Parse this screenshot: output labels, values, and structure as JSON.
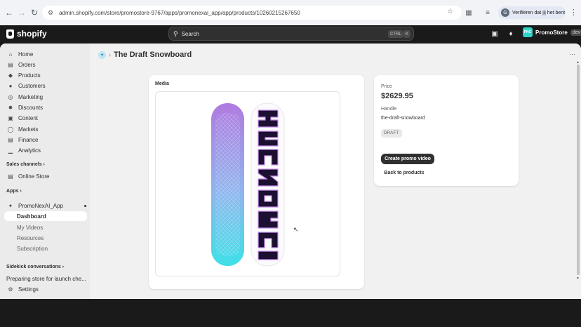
{
  "browser": {
    "url": "admin.shopify.com/store/promostore-9767/apps/promonexai_app/app/products/10260215267650",
    "profile_text": "Verifiëren dat jij het bent",
    "profile_icon": "G"
  },
  "topbar": {
    "logo": "shopify",
    "search_placeholder": "Search",
    "kbd_ctrl": "CTRL",
    "kbd_k": "K",
    "store_initials": "PNC",
    "store_name": "PromoStore",
    "store_tag": "dev"
  },
  "sidebar": {
    "items": [
      {
        "label": "Home",
        "icon": "home-icon"
      },
      {
        "label": "Orders",
        "icon": "inbox-icon"
      },
      {
        "label": "Products",
        "icon": "tag-icon"
      },
      {
        "label": "Customers",
        "icon": "person-icon"
      },
      {
        "label": "Marketing",
        "icon": "target-icon"
      },
      {
        "label": "Discounts",
        "icon": "discount-icon"
      },
      {
        "label": "Content",
        "icon": "content-icon"
      },
      {
        "label": "Markets",
        "icon": "globe-icon"
      },
      {
        "label": "Finance",
        "icon": "bank-icon"
      },
      {
        "label": "Analytics",
        "icon": "chart-icon"
      }
    ],
    "sales_channels_header": "Sales channels",
    "online_store": "Online Store",
    "apps_header": "Apps",
    "app_name": "PromoNexAI_App",
    "app_items": [
      "Dashboard",
      "My Videos",
      "Resources",
      "Subscription"
    ],
    "sidekick_header": "Sidekick conversations",
    "sidekick_item": "Preparing store for launch che...",
    "settings": "Settings"
  },
  "page": {
    "breadcrumb_sep": "›",
    "title": "The Draft Snowboard",
    "media_header": "Media",
    "price_label": "Price",
    "price_value": "$2629.95",
    "handle_label": "Handle",
    "handle_value": "the-draft-snowboard",
    "status_badge": "DRAFT",
    "create_button": "Create promo video",
    "back_button": "Back to products"
  },
  "colors": {
    "accent_dark": "#303030",
    "store_avatar": "#2dd4c8",
    "board_gradient_top": "#b07ae0",
    "board_gradient_bottom": "#3ee0e8"
  }
}
